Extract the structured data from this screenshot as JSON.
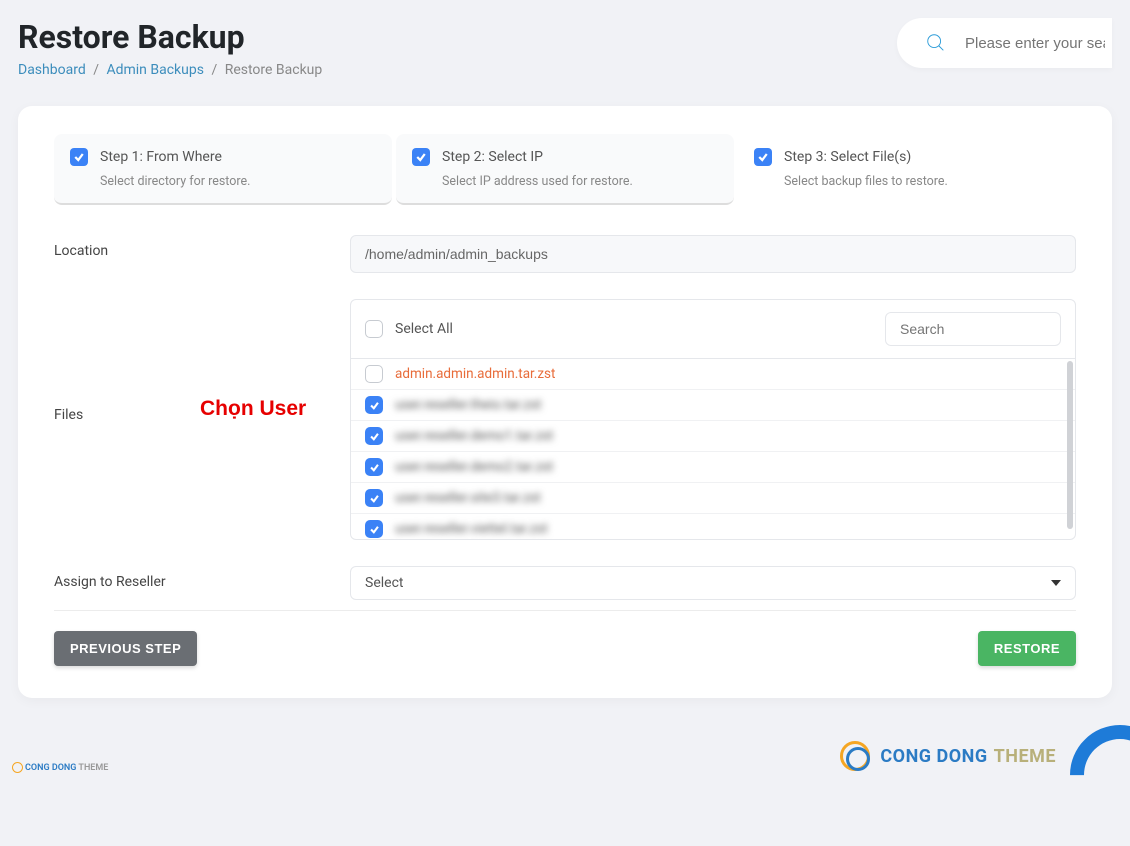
{
  "header": {
    "title": "Restore Backup",
    "breadcrumb": {
      "dashboard": "Dashboard",
      "admin_backups": "Admin Backups",
      "current": "Restore Backup"
    },
    "search_placeholder": "Please enter your sear"
  },
  "steps": [
    {
      "title": "Step 1: From Where",
      "desc": "Select directory for restore.",
      "checked": true
    },
    {
      "title": "Step 2: Select IP",
      "desc": "Select IP address used for restore.",
      "checked": true
    },
    {
      "title": "Step 3: Select File(s)",
      "desc": "Select backup files to restore.",
      "checked": true
    }
  ],
  "location": {
    "label": "Location",
    "value": "/home/admin/admin_backups"
  },
  "files": {
    "label": "Files",
    "select_all_label": "Select All",
    "search_placeholder": "Search",
    "items": [
      {
        "name": "admin.admin.admin.tar.zst",
        "checked": false,
        "highlight": true,
        "blurred": false
      },
      {
        "name": "user.reseller.theio.tar.zst",
        "checked": true,
        "highlight": false,
        "blurred": true
      },
      {
        "name": "user.reseller.demo1.tar.zst",
        "checked": true,
        "highlight": false,
        "blurred": true
      },
      {
        "name": "user.reseller.demo2.tar.zst",
        "checked": true,
        "highlight": false,
        "blurred": true
      },
      {
        "name": "user.reseller.site3.tar.zst",
        "checked": true,
        "highlight": false,
        "blurred": true
      },
      {
        "name": "user.reseller.viettel.tar.zst",
        "checked": true,
        "highlight": false,
        "blurred": true
      }
    ]
  },
  "reseller": {
    "label": "Assign to Reseller",
    "selected": "Select"
  },
  "buttons": {
    "previous": "PREVIOUS STEP",
    "restore": "RESTORE"
  },
  "annotation": "Chọn User",
  "brand": {
    "part1": "CONG DONG",
    "part2": "THEME"
  }
}
